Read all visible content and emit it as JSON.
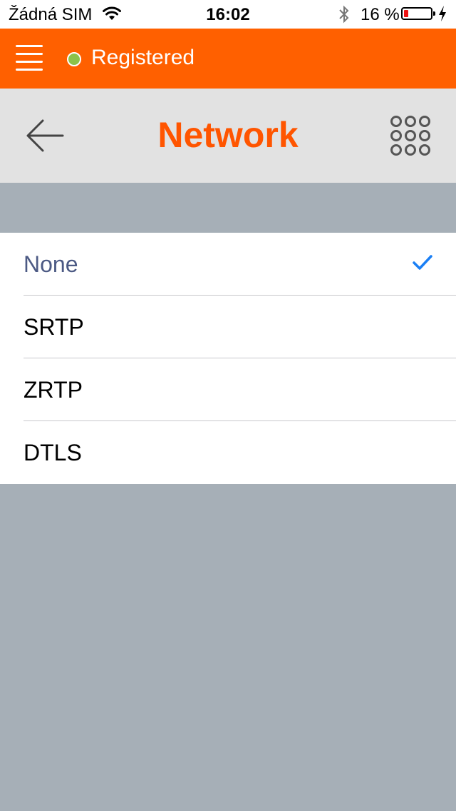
{
  "status_bar": {
    "carrier": "Žádná SIM",
    "time": "16:02",
    "battery_percent": "16 %",
    "battery_level": 0.16,
    "icons": [
      "wifi-icon",
      "bluetooth-icon",
      "battery-icon",
      "charging-bolt-icon"
    ]
  },
  "app_bar": {
    "registration_status": "Registered",
    "status_color": "#8bc34a",
    "background_color": "#ff6000",
    "menu_icon": "hamburger-menu-icon"
  },
  "header": {
    "title": "Network",
    "title_color": "#ff5500",
    "back_icon": "back-arrow-icon",
    "dialpad_icon": "dialpad-icon"
  },
  "options": {
    "items": [
      {
        "label": "None",
        "selected": true
      },
      {
        "label": "SRTP",
        "selected": false
      },
      {
        "label": "ZRTP",
        "selected": false
      },
      {
        "label": "DTLS",
        "selected": false
      }
    ],
    "check_color": "#1a7ff5"
  }
}
